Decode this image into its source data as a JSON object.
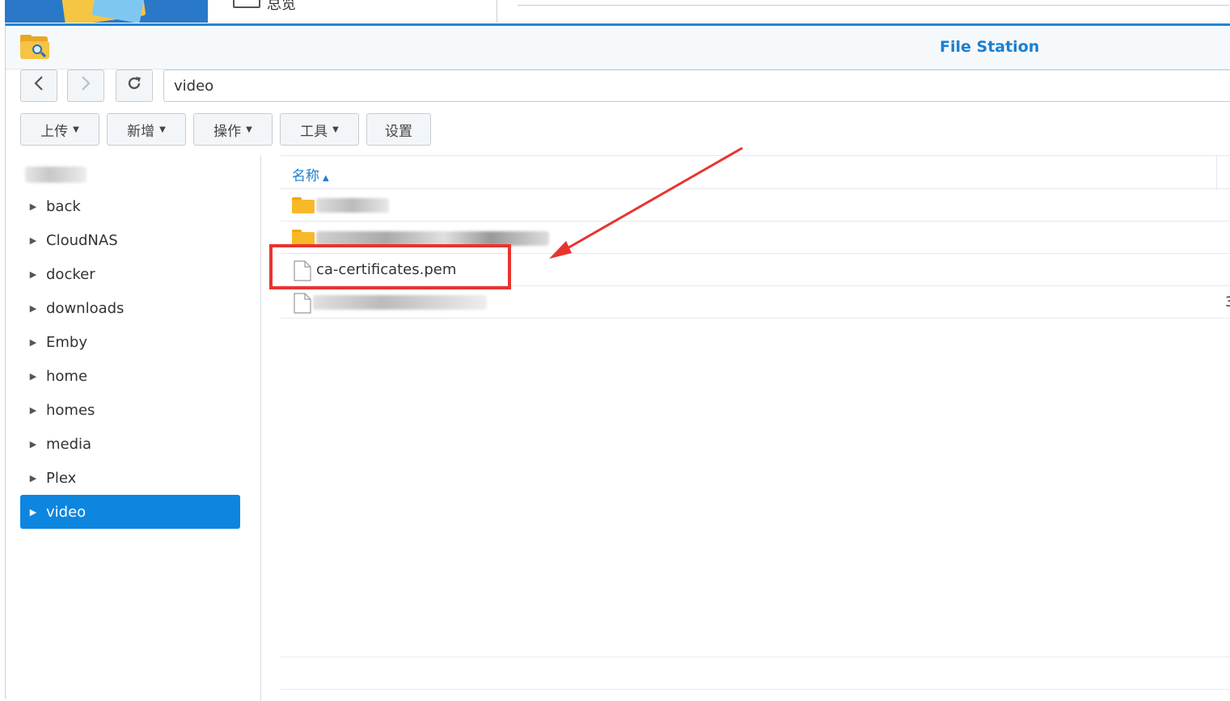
{
  "background_window": {
    "text": "总览"
  },
  "window": {
    "title": "File Station"
  },
  "nav": {
    "back_icon": "chevron-left-icon",
    "forward_icon": "chevron-right-icon",
    "refresh_glyph": "⟳",
    "path_value": "video"
  },
  "toolbar": {
    "upload": "上传",
    "create": "新增",
    "action": "操作",
    "tools": "工具",
    "settings": "设置"
  },
  "sidebar": {
    "items": [
      {
        "label": "back"
      },
      {
        "label": "CloudNAS"
      },
      {
        "label": "docker"
      },
      {
        "label": "downloads"
      },
      {
        "label": "Emby"
      },
      {
        "label": "home"
      },
      {
        "label": "homes"
      },
      {
        "label": "media"
      },
      {
        "label": "Plex"
      },
      {
        "label": "video"
      }
    ],
    "selected": "video"
  },
  "file_list": {
    "column_name": "名称",
    "sort_glyph": "▲",
    "rows": [
      {
        "type": "folder",
        "name": ""
      },
      {
        "type": "folder",
        "name": ""
      },
      {
        "type": "file",
        "name": "ca-certificates.pem"
      },
      {
        "type": "file",
        "name": "",
        "size_partial": "3"
      }
    ]
  },
  "colors": {
    "accent": "#0d86e0",
    "title": "#1b7fd0",
    "annotation": "#e8342f",
    "folder": "#f7b928"
  }
}
